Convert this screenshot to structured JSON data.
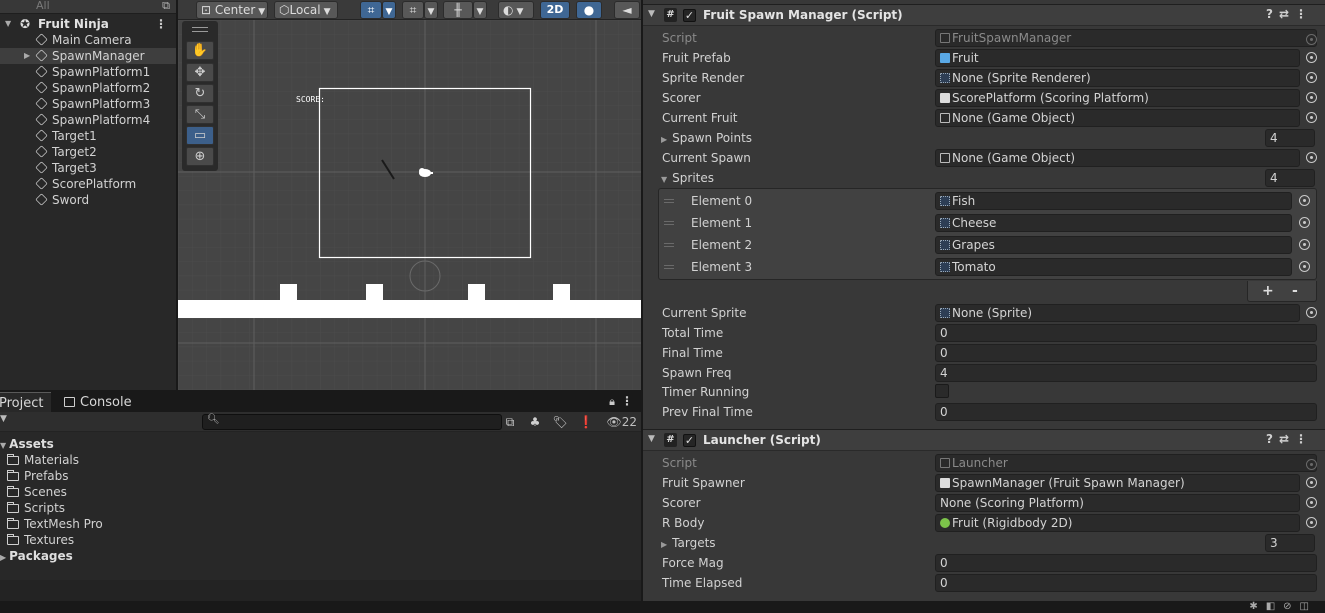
{
  "hierarchy": {
    "search_placeholder": "All",
    "scene_name": "Fruit Ninja",
    "objects": [
      "Main Camera",
      "SpawnManager",
      "SpawnPlatform1",
      "SpawnPlatform2",
      "SpawnPlatform3",
      "SpawnPlatform4",
      "Target1",
      "Target2",
      "Target3",
      "ScorePlatform",
      "Sword"
    ],
    "selected_object": "SpawnManager"
  },
  "scene_toolbar": {
    "pivot": "Center",
    "space": "Local",
    "mode_2d": "2D"
  },
  "scene": {
    "score_label": "SCORE:"
  },
  "project": {
    "tabs": [
      "Project",
      "Console"
    ],
    "hidden_count": "22",
    "assets_label": "Assets",
    "folders": [
      "Materials",
      "Prefabs",
      "Scenes",
      "Scripts",
      "TextMesh Pro",
      "Textures"
    ],
    "packages_label": "Packages"
  },
  "inspector": {
    "fruit_spawn_manager": {
      "title": "Fruit Spawn Manager (Script)",
      "script_label": "Script",
      "script_value": "FruitSpawnManager",
      "fruit_prefab_label": "Fruit Prefab",
      "fruit_prefab_value": "Fruit",
      "sprite_render_label": "Sprite Render",
      "sprite_render_value": "None (Sprite Renderer)",
      "scorer_label": "Scorer",
      "scorer_value": "ScorePlatform (Scoring Platform)",
      "current_fruit_label": "Current Fruit",
      "current_fruit_value": "None (Game Object)",
      "spawn_points_label": "Spawn Points",
      "spawn_points_size": "4",
      "current_spawn_label": "Current Spawn",
      "current_spawn_value": "None (Game Object)",
      "sprites_label": "Sprites",
      "sprites_size": "4",
      "sprites": [
        {
          "label": "Element 0",
          "value": "Fish"
        },
        {
          "label": "Element 1",
          "value": "Cheese"
        },
        {
          "label": "Element 2",
          "value": "Grapes"
        },
        {
          "label": "Element 3",
          "value": "Tomato"
        }
      ],
      "add_label": "+",
      "remove_label": "-",
      "current_sprite_label": "Current Sprite",
      "current_sprite_value": "None (Sprite)",
      "total_time_label": "Total Time",
      "total_time_value": "0",
      "final_time_label": "Final Time",
      "final_time_value": "0",
      "spawn_freq_label": "Spawn Freq",
      "spawn_freq_value": "4",
      "timer_running_label": "Timer Running",
      "timer_running_value": false,
      "prev_final_time_label": "Prev Final Time",
      "prev_final_time_value": "0"
    },
    "launcher": {
      "title": "Launcher (Script)",
      "script_label": "Script",
      "script_value": "Launcher",
      "fruit_spawner_label": "Fruit Spawner",
      "fruit_spawner_value": "SpawnManager (Fruit Spawn Manager)",
      "scorer_label": "Scorer",
      "scorer_value": "None (Scoring Platform)",
      "rbody_label": "R Body",
      "rbody_value": "Fruit (Rigidbody 2D)",
      "targets_label": "Targets",
      "targets_size": "3",
      "force_mag_label": "Force Mag",
      "force_mag_value": "0",
      "time_elapsed_label": "Time Elapsed",
      "time_elapsed_value": "0"
    }
  },
  "colors": {
    "accent": "#3f6794",
    "panel": "#383838",
    "field": "#2a2a2a"
  }
}
